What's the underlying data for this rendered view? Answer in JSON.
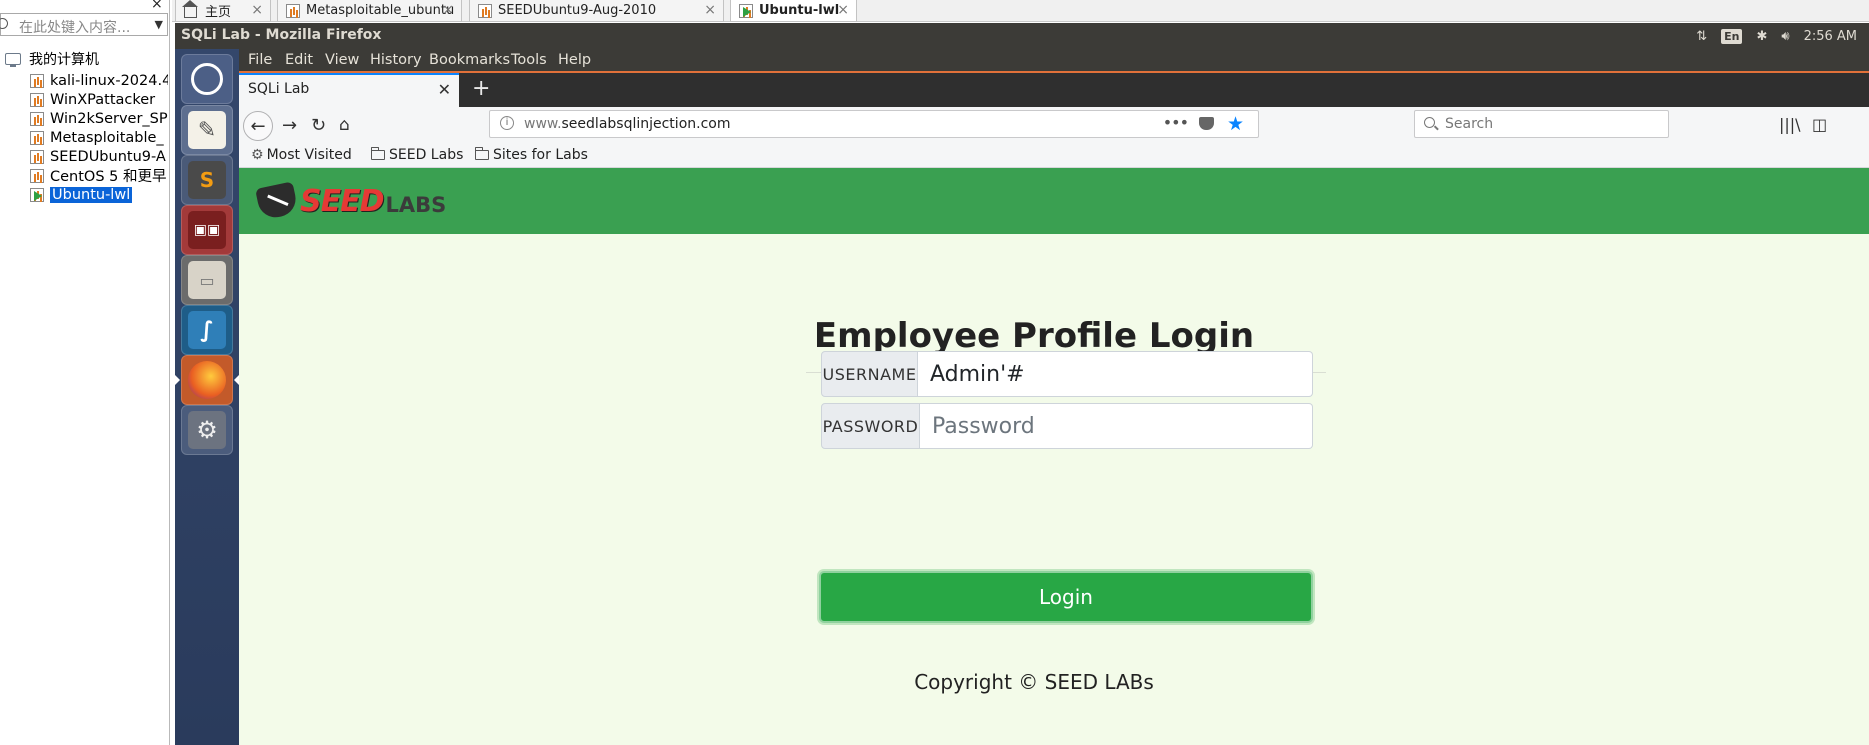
{
  "vmware": {
    "search_placeholder": "在此处键入内容...",
    "tree_root": "我的计算机",
    "vms": [
      {
        "label": "kali-linux-2024.4"
      },
      {
        "label": "WinXPattacker"
      },
      {
        "label": "Win2kServer_SP"
      },
      {
        "label": "Metasploitable_"
      },
      {
        "label": "SEEDUbuntu9-A"
      },
      {
        "label": "CentOS 5 和更早"
      },
      {
        "label": "Ubuntu-lwl"
      }
    ],
    "tabs": [
      {
        "label": "主页"
      },
      {
        "label": "Metasploitable_ubuntu"
      },
      {
        "label": "SEEDUbuntu9-Aug-2010"
      },
      {
        "label": "Ubuntu-lwl"
      }
    ]
  },
  "ubuntu_panel": {
    "window_title": "SQLi Lab - Mozilla Firefox",
    "lang": "En",
    "clock": "2:56 AM"
  },
  "firefox": {
    "menu": [
      "File",
      "Edit",
      "View",
      "History",
      "Bookmarks",
      "Tools",
      "Help"
    ],
    "tab_title": "SQLi Lab",
    "url_prefix": "www.",
    "url_domain": "seedlabsqlinjection.com",
    "search_placeholder": "Search",
    "bookmarks": [
      "Most Visited",
      "SEED Labs",
      "Sites for Labs"
    ]
  },
  "page": {
    "logo_text": "SEED",
    "logo_sub": "LABS",
    "title": "Employee Profile Login",
    "username_label": "USERNAME",
    "username_value": "Admin'#",
    "password_label": "PASSWORD",
    "password_placeholder": "Password",
    "login_label": "Login",
    "copyright": "Copyright © SEED LABs"
  },
  "colors": {
    "header_green": "#3aa051",
    "page_bg": "#f3fbe9",
    "button_green": "#28a745",
    "launcher_blue": "#2f4266",
    "panel_dark": "#3c3b37"
  },
  "icons": [
    "search-icon",
    "computer-icon",
    "vm-icon",
    "home-icon",
    "close-icon",
    "ubuntu-dash-icon",
    "text-editor-icon",
    "sublime-icon",
    "terminal-icon",
    "file-manager-icon",
    "wireshark-icon",
    "firefox-icon",
    "settings-icon",
    "back-icon",
    "forward-icon",
    "reload-icon",
    "info-icon",
    "pocket-icon",
    "bookmark-star-icon",
    "library-icon",
    "sidebar-icon"
  ]
}
